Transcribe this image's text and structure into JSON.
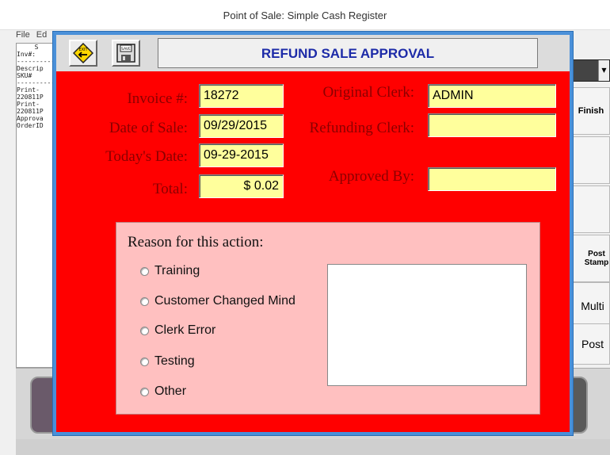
{
  "window": {
    "title": "Point of Sale: Simple Cash Register"
  },
  "menu": {
    "items": [
      "File",
      "Ed"
    ]
  },
  "background": {
    "receipt_lines": [
      "S",
      "",
      "",
      "",
      "",
      "",
      "",
      "",
      "Inv#:",
      "",
      "",
      "",
      "",
      "",
      "",
      "----------",
      "Descrip",
      "SKU#",
      "----------",
      "Print-",
      "220811P",
      "Print-",
      "220811P",
      "Approva",
      "OrderID"
    ],
    "right_buttons": [
      "Finish",
      "",
      "",
      "Post Stamp",
      "Multi",
      "Post"
    ],
    "dropdown_glyph": "▼"
  },
  "dialog": {
    "title": "REFUND SALE APPROVAL",
    "exit_icon_text": "EXIT",
    "save_icon_text": "SAVE",
    "invoice_label": "Invoice #:",
    "invoice_value": "18272",
    "date_of_sale_label": "Date of Sale:",
    "date_of_sale_value": "09/29/2015",
    "todays_date_label": "Today's Date:",
    "todays_date_value": "09-29-2015",
    "total_label": "Total:",
    "total_value": "$ 0.02",
    "original_clerk_label": "Original Clerk:",
    "original_clerk_value": "ADMIN",
    "refunding_clerk_label": "Refunding Clerk:",
    "refunding_clerk_value": "",
    "approved_by_label": "Approved By:",
    "approved_by_value": "",
    "reason": {
      "title": "Reason for this action:",
      "options": [
        "Training",
        "Customer Changed Mind",
        "Clerk Error",
        "Testing",
        "Other"
      ],
      "notes_value": ""
    }
  },
  "colors": {
    "dialog_body": "#ff0000",
    "label_text": "#8b0000",
    "field_bg": "#ffff9c",
    "reason_panel": "#ffc0c0",
    "title_text": "#1d2ba8",
    "dialog_border": "#4a90d9"
  }
}
